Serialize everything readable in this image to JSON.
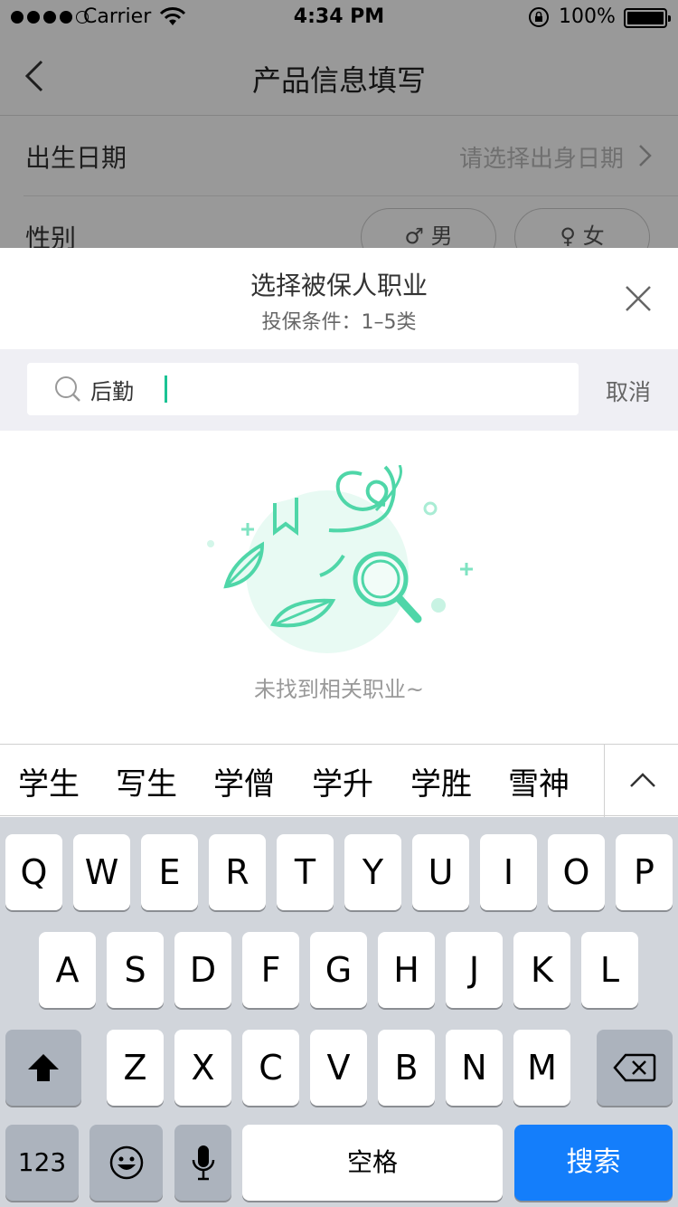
{
  "status_bar": {
    "carrier": "Carrier",
    "time": "4:34 PM",
    "battery": "100%"
  },
  "background": {
    "nav_title": "产品信息填写",
    "birth_label": "出生日期",
    "birth_placeholder": "请选择出身日期",
    "gender_label": "性别",
    "male": "♂ 男",
    "female": "♀ 女"
  },
  "sheet": {
    "title": "选择被保人职业",
    "subtitle": "投保条件：1–5类",
    "search_value": "后勤",
    "cancel": "取消",
    "empty_text": "未找到相关职业~"
  },
  "candidates": [
    "学生",
    "写生",
    "学僧",
    "学升",
    "学胜",
    "雪神"
  ],
  "keyboard": {
    "row1": [
      "Q",
      "W",
      "E",
      "R",
      "T",
      "Y",
      "U",
      "I",
      "O",
      "P"
    ],
    "row2": [
      "A",
      "S",
      "D",
      "F",
      "G",
      "H",
      "J",
      "K",
      "L"
    ],
    "row3": [
      "Z",
      "X",
      "C",
      "V",
      "B",
      "N",
      "M"
    ],
    "numbers": "123",
    "space": "空格",
    "search": "搜索"
  },
  "colors": {
    "accent": "#1bc394",
    "illustration": "#5dd9b0",
    "keyboard_bg": "#d1d5db",
    "search_key": "#147efb"
  }
}
